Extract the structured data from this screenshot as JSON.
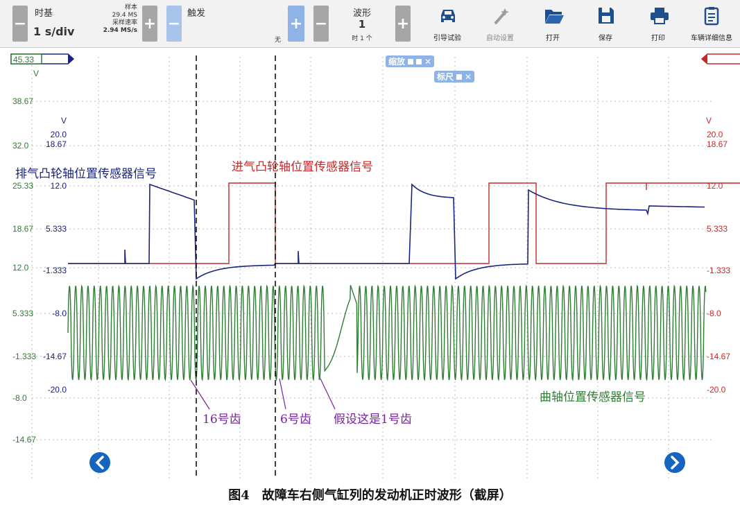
{
  "toolbar": {
    "timebase": {
      "title": "时基",
      "value": "1 s/div",
      "samples_label": "样本",
      "samples_value": "29.4 MS",
      "rate_label": "采样速率",
      "rate_value": "2.94 MS/s",
      "minus": "−",
      "plus": "+"
    },
    "trigger": {
      "title": "触发",
      "mode": "无",
      "minus": "−",
      "plus": "+"
    },
    "waveform": {
      "title": "波形",
      "value": "1",
      "subtitle": "时 1 个",
      "minus": "−",
      "plus": "+"
    },
    "tools": [
      {
        "label": "引导试验",
        "icon": "car-icon"
      },
      {
        "label": "自动设置",
        "icon": "wand-icon"
      },
      {
        "label": "打开",
        "icon": "folder-icon"
      },
      {
        "label": "保存",
        "icon": "save-icon"
      },
      {
        "label": "打印",
        "icon": "printer-icon"
      },
      {
        "label": "车辆详细信息",
        "icon": "clipboard-icon"
      }
    ]
  },
  "plot": {
    "left_marker": "45.33",
    "left_unit": "V",
    "left_axis_green": [
      "38.67",
      "32.0",
      "25.33",
      "18.67",
      "12.0",
      "5.333",
      "-1.333",
      "-8.0",
      "-14.67"
    ],
    "left_axis_blue_unit": "V",
    "left_axis_blue": [
      "20.0",
      "18.67",
      "12.0",
      "5.333",
      "-1.333",
      "-8.0",
      "-14.67",
      "-20.0"
    ],
    "right_unit": "V",
    "right_axis": [
      "20.0",
      "18.67",
      "12.0",
      "5.333",
      "-1.333",
      "-8.0",
      "-14.67",
      "-20.0"
    ],
    "zoom_tag": "缩放",
    "ruler_tag": "标尺",
    "annotations": {
      "exhaust": "排气凸轮轴位置传感器信号",
      "intake": "进气凸轮轴位置传感器信号",
      "crank": "曲轴位置传感器信号",
      "tooth16": "16号齿",
      "tooth6": "6号齿",
      "tooth1": "假设这是1号齿"
    },
    "colors": {
      "exhaust": "#1a237e",
      "intake": "#c62828",
      "crank": "#2e7d32",
      "annotation_purple": "#7b1fa2",
      "grid": "#b0b0b0"
    }
  },
  "caption": "图4　故障车右侧气缸列的发动机正时波形（截屏）"
}
